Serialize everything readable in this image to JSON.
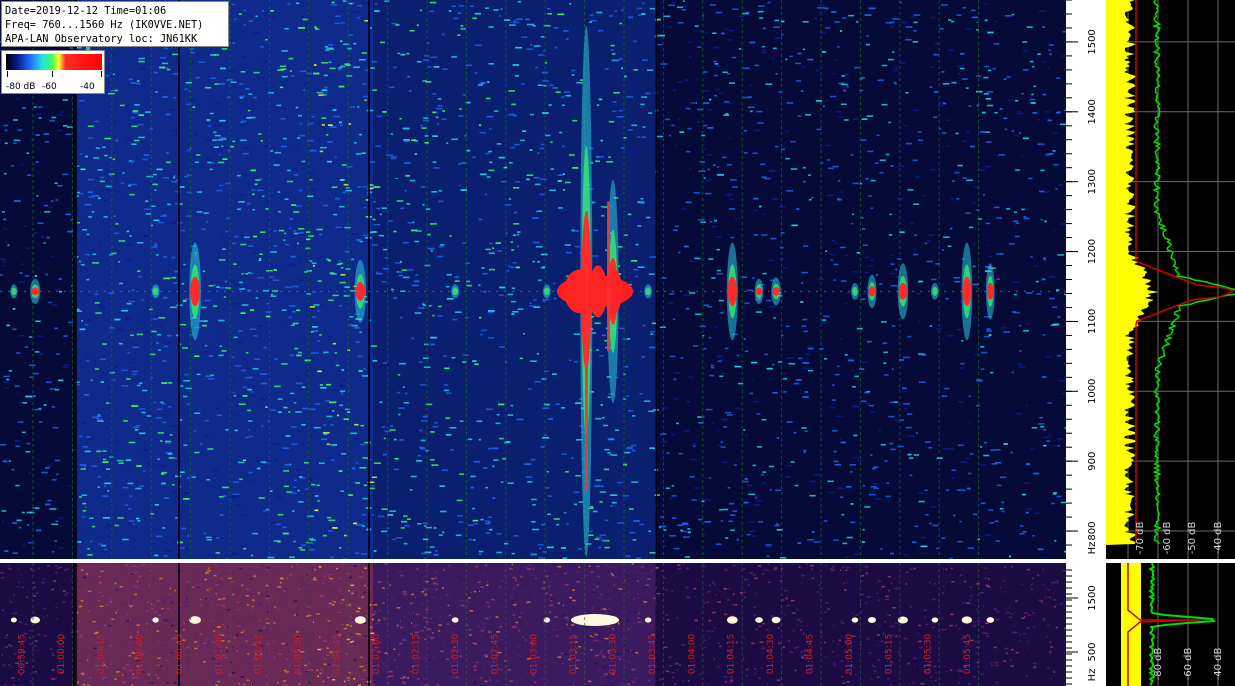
{
  "header": {
    "line1": "Date=2019-12-12 Time=01:06",
    "line2": "Freq= 760...1560 Hz (IK0VVE.NET)",
    "line3": "APA-LAN Observatory loc: JN61KK"
  },
  "color_scale": {
    "labels": [
      "-80 dB",
      "-60",
      "-40"
    ],
    "colors": [
      "#000000",
      "#0a1a8c",
      "#1e6cff",
      "#27e0e0",
      "#3dff5a",
      "#ffff2a",
      "#ff2b2b",
      "#ff0000"
    ]
  },
  "chart_data": [
    {
      "type": "heatmap",
      "name": "spectrogram",
      "ylabel": "Hz",
      "ylim": [
        760,
        1560
      ],
      "yticks": [
        800,
        900,
        1000,
        1100,
        1200,
        1300,
        1400,
        1500
      ],
      "carrier_hz": 1143,
      "background": [
        {
          "from_frac": 0.0,
          "to_frac": 0.07,
          "level": 0.35
        },
        {
          "from_frac": 0.07,
          "to_frac": 0.29,
          "level": 0.65
        },
        {
          "from_frac": 0.29,
          "to_frac": 0.35,
          "level": 0.8
        },
        {
          "from_frac": 0.35,
          "to_frac": 0.615,
          "level": 0.55
        },
        {
          "from_frac": 0.615,
          "to_frac": 1.0,
          "level": 0.3
        }
      ],
      "echoes": [
        {
          "pos": 0.013,
          "strength": 0.25,
          "spread_hz": 10
        },
        {
          "pos": 0.033,
          "strength": 0.7,
          "spread_hz": 18
        },
        {
          "pos": 0.146,
          "strength": 0.3,
          "spread_hz": 10
        },
        {
          "pos": 0.183,
          "strength": 0.95,
          "spread_hz": 70
        },
        {
          "pos": 0.338,
          "strength": 0.9,
          "spread_hz": 45
        },
        {
          "pos": 0.427,
          "strength": 0.35,
          "spread_hz": 10
        },
        {
          "pos": 0.513,
          "strength": 0.3,
          "spread_hz": 10
        },
        {
          "pos": 0.55,
          "strength": 1.0,
          "spread_hz": 380
        },
        {
          "pos": 0.575,
          "strength": 0.9,
          "spread_hz": 160
        },
        {
          "pos": 0.608,
          "strength": 0.3,
          "spread_hz": 10
        },
        {
          "pos": 0.687,
          "strength": 0.85,
          "spread_hz": 70
        },
        {
          "pos": 0.712,
          "strength": 0.45,
          "spread_hz": 18
        },
        {
          "pos": 0.728,
          "strength": 0.6,
          "spread_hz": 20
        },
        {
          "pos": 0.802,
          "strength": 0.3,
          "spread_hz": 12
        },
        {
          "pos": 0.818,
          "strength": 0.5,
          "spread_hz": 24
        },
        {
          "pos": 0.847,
          "strength": 0.75,
          "spread_hz": 40
        },
        {
          "pos": 0.877,
          "strength": 0.3,
          "spread_hz": 12
        },
        {
          "pos": 0.907,
          "strength": 0.8,
          "spread_hz": 70
        },
        {
          "pos": 0.929,
          "strength": 0.45,
          "spread_hz": 40
        }
      ]
    },
    {
      "type": "line",
      "name": "spectrum-profile",
      "xlabel": "dB",
      "xticks": [
        "-70 dB",
        "-60 dB",
        "-50 dB",
        "-40 dB"
      ],
      "ylabel": "Hz",
      "ylim": [
        760,
        1560
      ],
      "yticks": [
        800,
        900,
        1000,
        1100,
        1200,
        1300,
        1400,
        1500
      ],
      "series": [
        {
          "color": "#ffff00"
        },
        {
          "color": "#00e000"
        },
        {
          "color": "#d00000"
        }
      ]
    },
    {
      "type": "heatmap",
      "name": "overview-spectrogram",
      "xlabel": "time",
      "xticks": [
        "00:59:45",
        "01:00:00",
        "01:00:15",
        "01:00:30",
        "01:00:45",
        "01:01:00",
        "01:01:15",
        "01:01:30",
        "01:01:45",
        "01:02:00",
        "01:02:15",
        "01:02:30",
        "01:02:45",
        "01:03:00",
        "01:03:15",
        "01:03:30",
        "01:03:45",
        "01:04:00",
        "01:04:15",
        "01:04:30",
        "01:04:45",
        "01:05:00",
        "01:05:15",
        "01:05:30",
        "01:05:45"
      ],
      "ylabel": "Hz",
      "yticks": [
        500,
        1500
      ]
    },
    {
      "type": "line",
      "name": "overview-profile",
      "xticks": [
        "-80 dB",
        "-60 dB",
        "-40 dB"
      ]
    }
  ]
}
